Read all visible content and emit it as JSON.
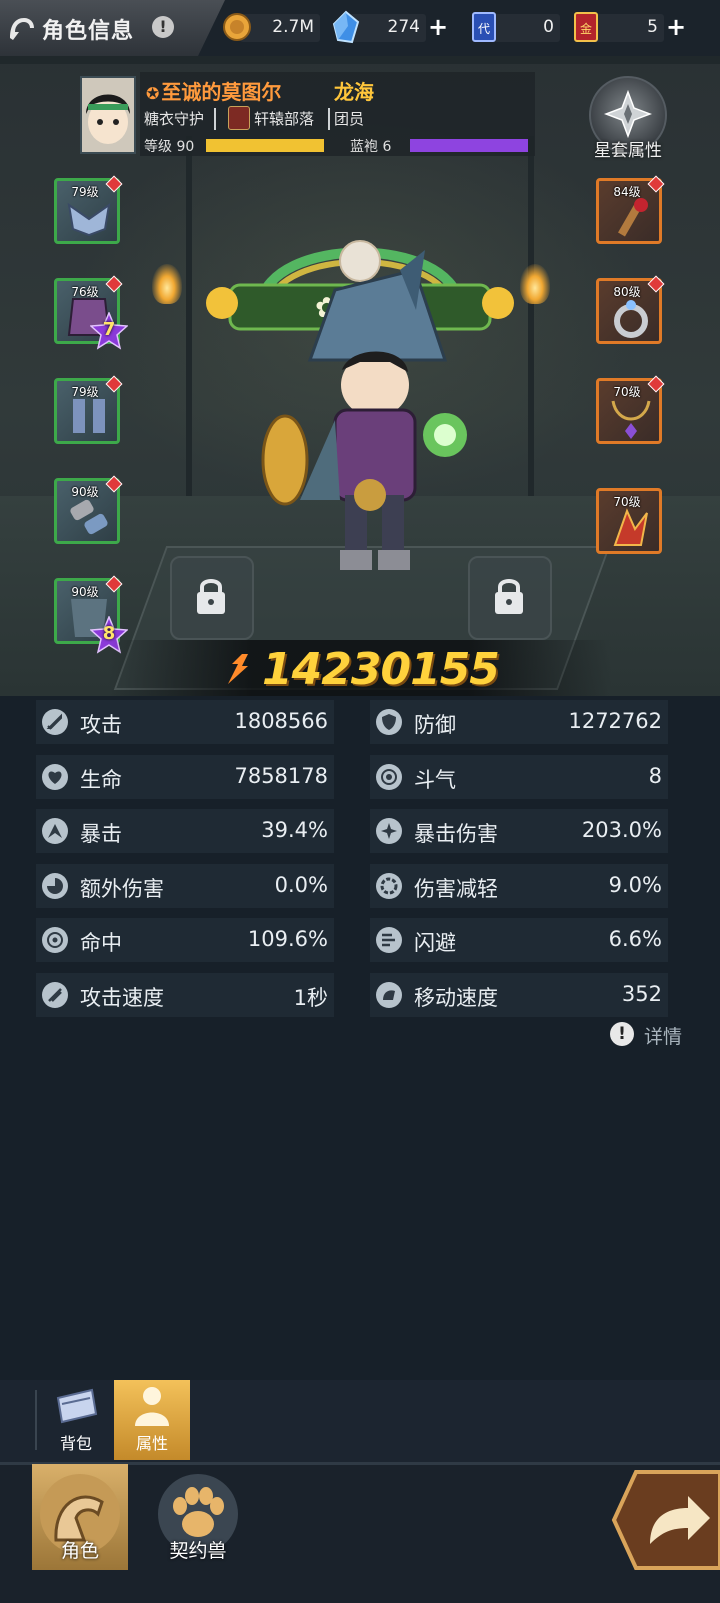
{
  "header": {
    "title": "角色信息",
    "resources": [
      {
        "id": "gold",
        "value": "2.7M",
        "icon": "gold-coin-icon",
        "has_plus": false
      },
      {
        "id": "crystal",
        "value": "274",
        "icon": "blue-crystal-icon",
        "has_plus": true
      },
      {
        "id": "blue_ticket",
        "value": "0",
        "icon": "blue-card-icon",
        "has_plus": false
      },
      {
        "id": "gold_ticket",
        "value": "5",
        "icon": "red-gold-card-icon",
        "has_plus": true
      }
    ]
  },
  "profile": {
    "hero_name": "至诚的莫图尔",
    "player_name": "龙海",
    "guild": "糖衣守护",
    "tribe": "轩辕部落",
    "role": "团员",
    "level_label": "等级 90",
    "level_progress": 1.0,
    "robe_label": "蓝袍 6",
    "robe_progress": 1.0,
    "level_color": "#f1c232",
    "robe_color": "#8e44e0"
  },
  "set_attributes_label": "星套属性",
  "equipment": {
    "left": [
      {
        "level": "79级",
        "rarity": "green",
        "icon": "shoulder-armor-icon",
        "star": null
      },
      {
        "level": "76级",
        "rarity": "green",
        "icon": "chest-armor-icon",
        "star": "7"
      },
      {
        "level": "79级",
        "rarity": "green",
        "icon": "boots-icon",
        "star": null
      },
      {
        "level": "90级",
        "rarity": "green",
        "icon": "bracers-icon",
        "star": null
      },
      {
        "level": "90级",
        "rarity": "green",
        "icon": "cape-icon",
        "star": "8"
      }
    ],
    "right": [
      {
        "level": "84级",
        "rarity": "orange",
        "icon": "scepter-icon"
      },
      {
        "level": "80级",
        "rarity": "orange",
        "icon": "ring-icon"
      },
      {
        "level": "70级",
        "rarity": "orange",
        "icon": "necklace-icon"
      },
      {
        "level": "70级",
        "rarity": "orange",
        "icon": "artifact-icon"
      }
    ]
  },
  "combat_power": "14230155",
  "stats": [
    {
      "name": "攻击",
      "value": "1808566",
      "icon": "sword-icon"
    },
    {
      "name": "防御",
      "value": "1272762",
      "icon": "shield-icon"
    },
    {
      "name": "生命",
      "value": "7858178",
      "icon": "heart-icon"
    },
    {
      "name": "斗气",
      "value": "8",
      "icon": "swirl-icon"
    },
    {
      "name": "暴击",
      "value": "39.4%",
      "icon": "crit-icon"
    },
    {
      "name": "暴击伤害",
      "value": "203.0%",
      "icon": "burst-icon"
    },
    {
      "name": "额外伤害",
      "value": "0.0%",
      "icon": "extra-damage-icon"
    },
    {
      "name": "伤害减轻",
      "value": "9.0%",
      "icon": "damage-reduction-icon"
    },
    {
      "name": "命中",
      "value": "109.6%",
      "icon": "target-icon"
    },
    {
      "name": "闪避",
      "value": "6.6%",
      "icon": "dodge-icon"
    },
    {
      "name": "攻击速度",
      "value": "1秒",
      "icon": "attack-speed-icon"
    },
    {
      "name": "移动速度",
      "value": "352",
      "icon": "move-speed-icon"
    }
  ],
  "details_label": "详情",
  "sub_tabs": [
    {
      "label": "背包",
      "icon": "backpack-icon",
      "active": false
    },
    {
      "label": "属性",
      "icon": "person-icon",
      "active": true
    }
  ],
  "nav": [
    {
      "label": "角色",
      "icon": "character-icon",
      "active": true
    },
    {
      "label": "契约兽",
      "icon": "paw-icon",
      "active": false
    }
  ]
}
